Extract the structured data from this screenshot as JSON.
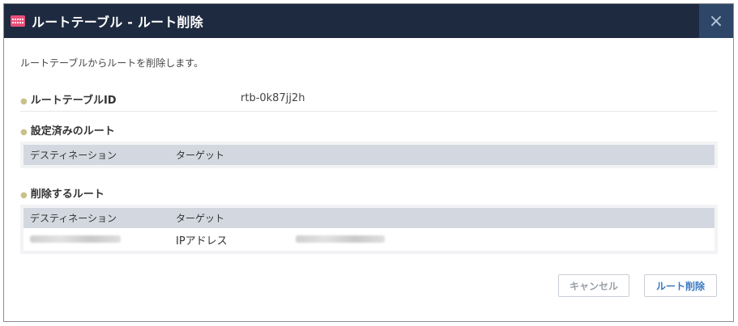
{
  "dialog": {
    "title": "ルートテーブル - ルート削除",
    "close_symbol": "×",
    "description": "ルートテーブルからルートを削除します。"
  },
  "route_table_id": {
    "label": "ルートテーブルID",
    "value": "rtb-0k87jj2h"
  },
  "existing_routes": {
    "label": "設定済みのルート",
    "columns": [
      "デスティネーション",
      "ターゲット"
    ]
  },
  "routes_to_delete": {
    "label": "削除するルート",
    "columns": [
      "デスティネーション",
      "ターゲット"
    ],
    "rows": [
      {
        "target_type": "IPアドレス"
      }
    ]
  },
  "buttons": {
    "cancel": "キャンセル",
    "delete": "ルート削除"
  },
  "colors": {
    "titlebar": "#1e2a40",
    "close_button": "#2e4768",
    "accent_link": "#3a78c0",
    "bullet": "#c8c18a",
    "table_header": "#d3d8e0"
  },
  "icons": {
    "title": "route-table-icon",
    "close": "close-icon",
    "bullet": "bullet-dot-icon"
  }
}
